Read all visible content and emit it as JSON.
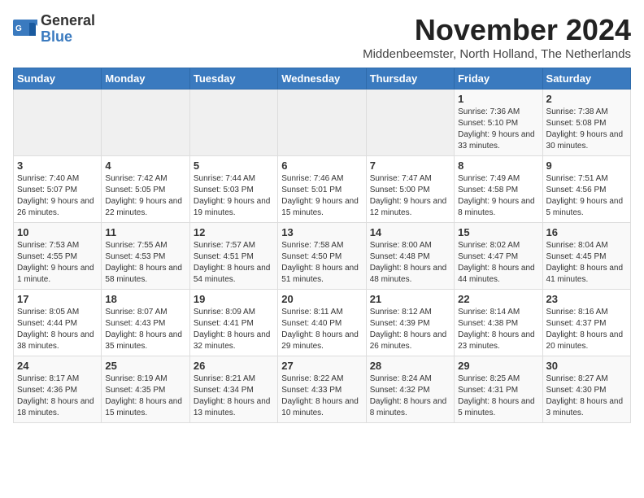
{
  "header": {
    "logo_line1": "General",
    "logo_line2": "Blue",
    "title": "November 2024",
    "location": "Middenbeemster, North Holland, The Netherlands"
  },
  "weekdays": [
    "Sunday",
    "Monday",
    "Tuesday",
    "Wednesday",
    "Thursday",
    "Friday",
    "Saturday"
  ],
  "weeks": [
    [
      {
        "day": "",
        "info": ""
      },
      {
        "day": "",
        "info": ""
      },
      {
        "day": "",
        "info": ""
      },
      {
        "day": "",
        "info": ""
      },
      {
        "day": "",
        "info": ""
      },
      {
        "day": "1",
        "info": "Sunrise: 7:36 AM\nSunset: 5:10 PM\nDaylight: 9 hours and 33 minutes."
      },
      {
        "day": "2",
        "info": "Sunrise: 7:38 AM\nSunset: 5:08 PM\nDaylight: 9 hours and 30 minutes."
      }
    ],
    [
      {
        "day": "3",
        "info": "Sunrise: 7:40 AM\nSunset: 5:07 PM\nDaylight: 9 hours and 26 minutes."
      },
      {
        "day": "4",
        "info": "Sunrise: 7:42 AM\nSunset: 5:05 PM\nDaylight: 9 hours and 22 minutes."
      },
      {
        "day": "5",
        "info": "Sunrise: 7:44 AM\nSunset: 5:03 PM\nDaylight: 9 hours and 19 minutes."
      },
      {
        "day": "6",
        "info": "Sunrise: 7:46 AM\nSunset: 5:01 PM\nDaylight: 9 hours and 15 minutes."
      },
      {
        "day": "7",
        "info": "Sunrise: 7:47 AM\nSunset: 5:00 PM\nDaylight: 9 hours and 12 minutes."
      },
      {
        "day": "8",
        "info": "Sunrise: 7:49 AM\nSunset: 4:58 PM\nDaylight: 9 hours and 8 minutes."
      },
      {
        "day": "9",
        "info": "Sunrise: 7:51 AM\nSunset: 4:56 PM\nDaylight: 9 hours and 5 minutes."
      }
    ],
    [
      {
        "day": "10",
        "info": "Sunrise: 7:53 AM\nSunset: 4:55 PM\nDaylight: 9 hours and 1 minute."
      },
      {
        "day": "11",
        "info": "Sunrise: 7:55 AM\nSunset: 4:53 PM\nDaylight: 8 hours and 58 minutes."
      },
      {
        "day": "12",
        "info": "Sunrise: 7:57 AM\nSunset: 4:51 PM\nDaylight: 8 hours and 54 minutes."
      },
      {
        "day": "13",
        "info": "Sunrise: 7:58 AM\nSunset: 4:50 PM\nDaylight: 8 hours and 51 minutes."
      },
      {
        "day": "14",
        "info": "Sunrise: 8:00 AM\nSunset: 4:48 PM\nDaylight: 8 hours and 48 minutes."
      },
      {
        "day": "15",
        "info": "Sunrise: 8:02 AM\nSunset: 4:47 PM\nDaylight: 8 hours and 44 minutes."
      },
      {
        "day": "16",
        "info": "Sunrise: 8:04 AM\nSunset: 4:45 PM\nDaylight: 8 hours and 41 minutes."
      }
    ],
    [
      {
        "day": "17",
        "info": "Sunrise: 8:05 AM\nSunset: 4:44 PM\nDaylight: 8 hours and 38 minutes."
      },
      {
        "day": "18",
        "info": "Sunrise: 8:07 AM\nSunset: 4:43 PM\nDaylight: 8 hours and 35 minutes."
      },
      {
        "day": "19",
        "info": "Sunrise: 8:09 AM\nSunset: 4:41 PM\nDaylight: 8 hours and 32 minutes."
      },
      {
        "day": "20",
        "info": "Sunrise: 8:11 AM\nSunset: 4:40 PM\nDaylight: 8 hours and 29 minutes."
      },
      {
        "day": "21",
        "info": "Sunrise: 8:12 AM\nSunset: 4:39 PM\nDaylight: 8 hours and 26 minutes."
      },
      {
        "day": "22",
        "info": "Sunrise: 8:14 AM\nSunset: 4:38 PM\nDaylight: 8 hours and 23 minutes."
      },
      {
        "day": "23",
        "info": "Sunrise: 8:16 AM\nSunset: 4:37 PM\nDaylight: 8 hours and 20 minutes."
      }
    ],
    [
      {
        "day": "24",
        "info": "Sunrise: 8:17 AM\nSunset: 4:36 PM\nDaylight: 8 hours and 18 minutes."
      },
      {
        "day": "25",
        "info": "Sunrise: 8:19 AM\nSunset: 4:35 PM\nDaylight: 8 hours and 15 minutes."
      },
      {
        "day": "26",
        "info": "Sunrise: 8:21 AM\nSunset: 4:34 PM\nDaylight: 8 hours and 13 minutes."
      },
      {
        "day": "27",
        "info": "Sunrise: 8:22 AM\nSunset: 4:33 PM\nDaylight: 8 hours and 10 minutes."
      },
      {
        "day": "28",
        "info": "Sunrise: 8:24 AM\nSunset: 4:32 PM\nDaylight: 8 hours and 8 minutes."
      },
      {
        "day": "29",
        "info": "Sunrise: 8:25 AM\nSunset: 4:31 PM\nDaylight: 8 hours and 5 minutes."
      },
      {
        "day": "30",
        "info": "Sunrise: 8:27 AM\nSunset: 4:30 PM\nDaylight: 8 hours and 3 minutes."
      }
    ]
  ]
}
